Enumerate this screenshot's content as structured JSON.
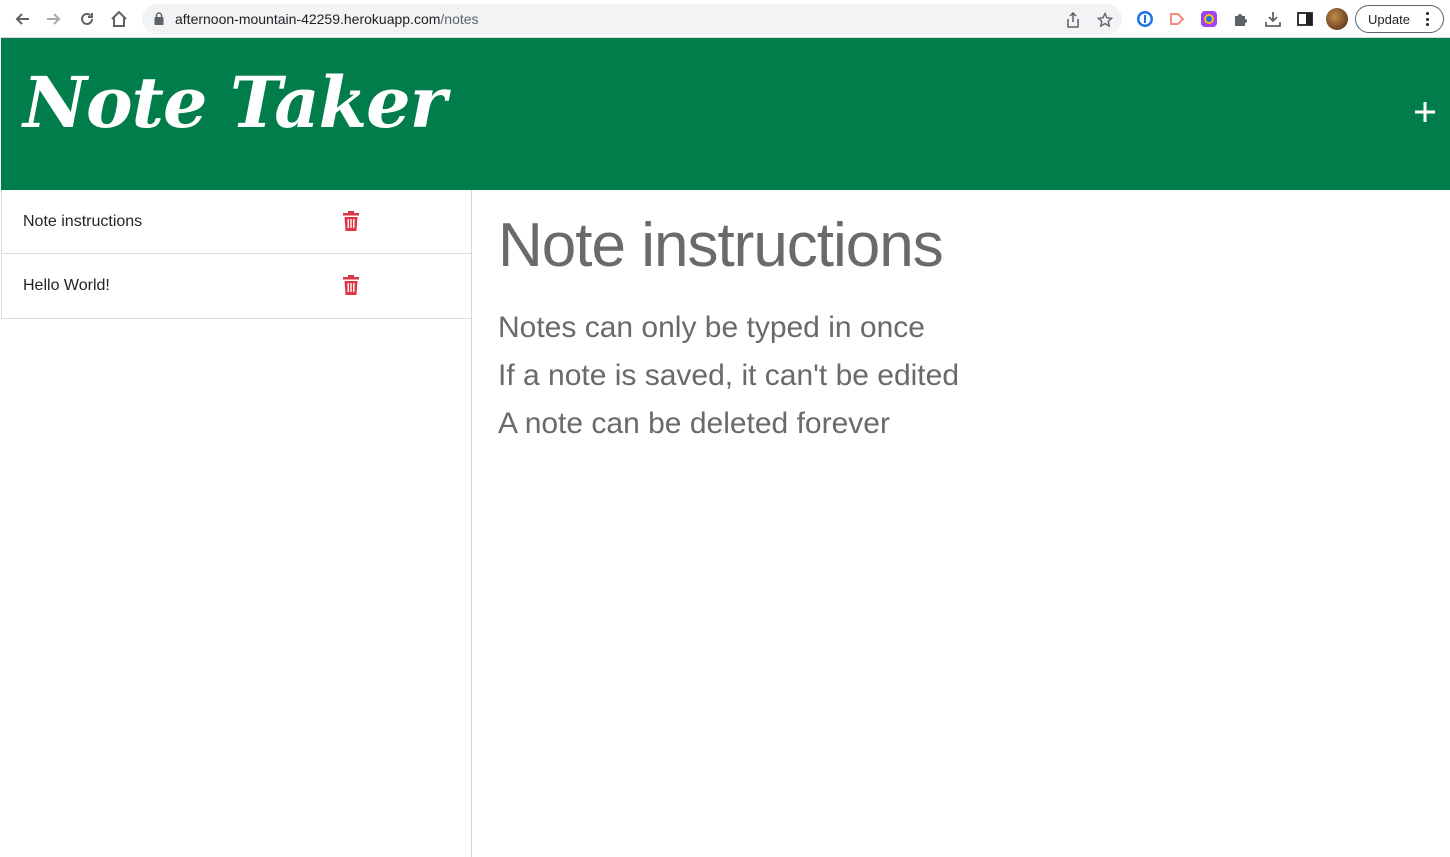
{
  "browser": {
    "url_host": "afternoon-mountain-42259.herokuapp.com",
    "url_path": "/notes",
    "update_label": "Update"
  },
  "app": {
    "title": "Note Taker",
    "header_color": "#017d4b",
    "new_note_icon": "plus-icon"
  },
  "notes": [
    {
      "title": "Note instructions"
    },
    {
      "title": "Hello World!"
    }
  ],
  "active_note": {
    "title": "Note instructions",
    "lines": [
      "Notes can only be typed in once",
      "If a note is saved, it can't be edited",
      "A note can be deleted forever"
    ]
  },
  "colors": {
    "delete_icon": "#dc3545",
    "note_text": "#6a6a6a"
  }
}
